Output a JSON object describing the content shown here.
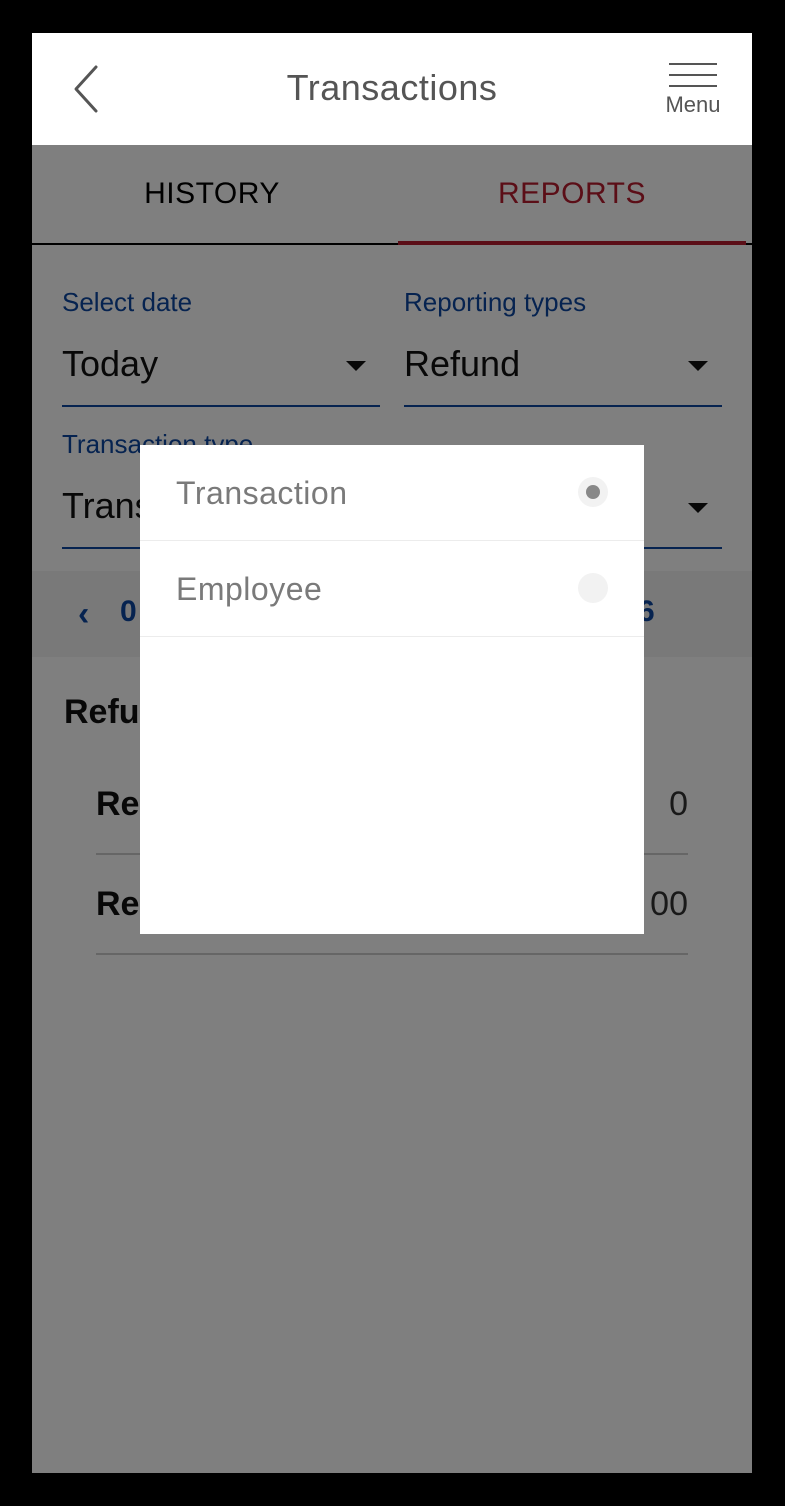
{
  "header": {
    "title": "Transactions",
    "menu_label": "Menu"
  },
  "tabs": [
    {
      "label": "HISTORY",
      "active": false
    },
    {
      "label": "REPORTS",
      "active": true
    }
  ],
  "filters": {
    "date": {
      "label": "Select date",
      "value": "Today"
    },
    "reporting": {
      "label": "Reporting types",
      "value": "Refund"
    },
    "transaction_type": {
      "label": "Transaction type",
      "value": "Trans"
    }
  },
  "date_nav": {
    "start": "0",
    "end": "6"
  },
  "summary": {
    "title": "Refu",
    "rows": [
      {
        "label": "Re",
        "value": "0"
      },
      {
        "label": "Re",
        "value": "00"
      }
    ]
  },
  "dialog": {
    "options": [
      {
        "label": "Transaction",
        "selected": true
      },
      {
        "label": "Employee",
        "selected": false
      }
    ]
  },
  "colors": {
    "accent": "#b71c2e",
    "link": "#0d47a1",
    "overlay": "rgba(0,0,0,0.5)"
  }
}
